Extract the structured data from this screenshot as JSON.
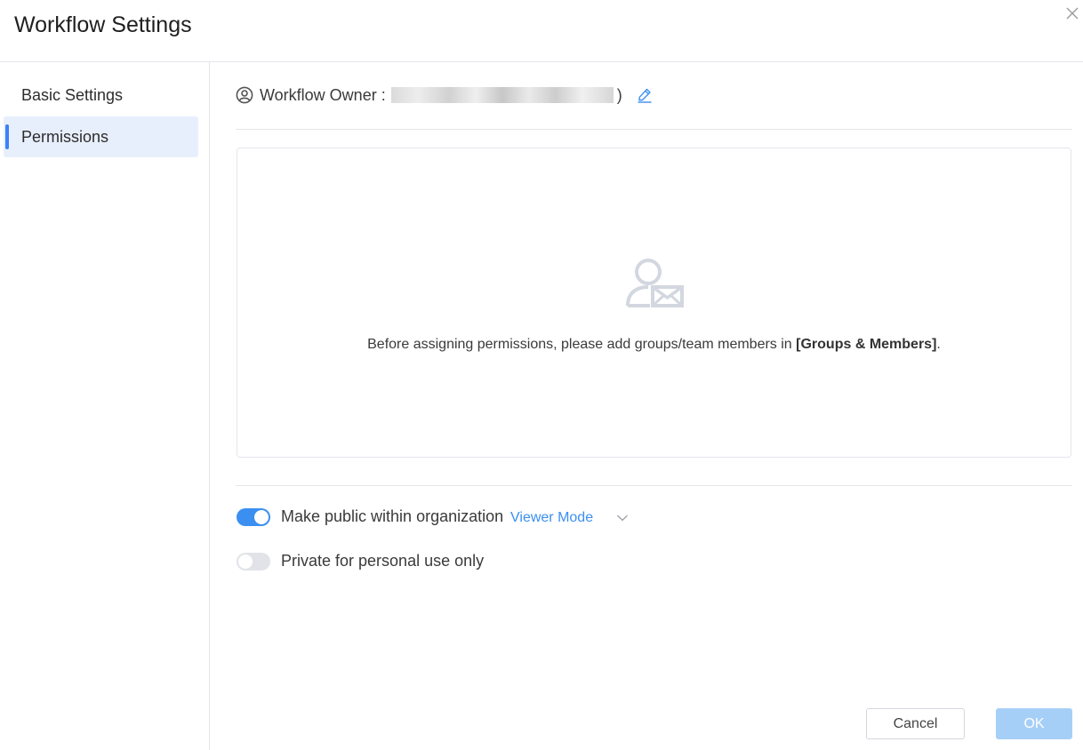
{
  "dialog": {
    "title": "Workflow Settings"
  },
  "sidebar": {
    "items": [
      {
        "label": "Basic Settings",
        "active": false
      },
      {
        "label": "Permissions",
        "active": true
      }
    ]
  },
  "owner": {
    "label": "Workflow Owner :",
    "suffix": ")",
    "icon": "user-circle-icon",
    "edit_icon": "pencil-icon"
  },
  "empty_state": {
    "icon": "user-mail-icon",
    "text_before": "Before assigning permissions, please add groups/team members in ",
    "link_text": "[Groups & Members]",
    "text_after": "."
  },
  "options": {
    "public": {
      "label": "Make public within organization",
      "enabled": true,
      "mode": "Viewer Mode"
    },
    "private": {
      "label": "Private for personal use only",
      "enabled": false
    }
  },
  "footer": {
    "cancel_label": "Cancel",
    "ok_label": "OK"
  },
  "colors": {
    "accent": "#3b8ff0",
    "ok_button_disabled": "#a6cff7",
    "nav_active_bg": "#e8effc",
    "toggle_off": "#e1e3e8"
  }
}
